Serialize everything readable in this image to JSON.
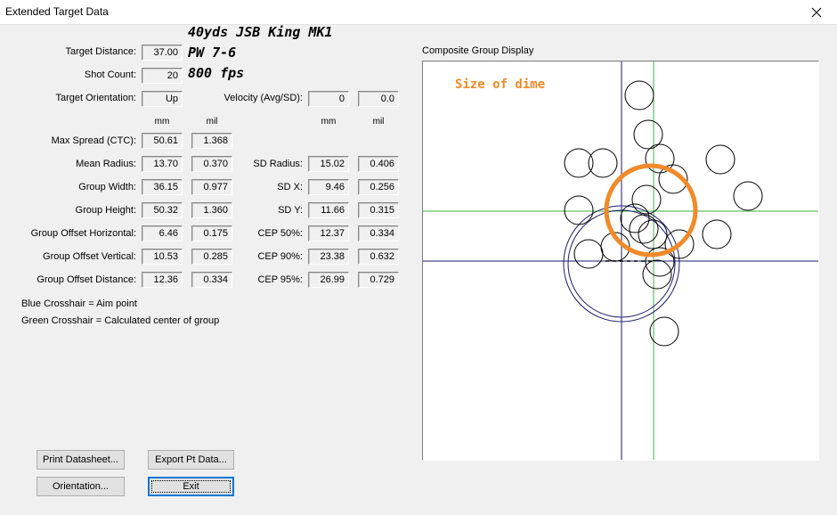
{
  "window": {
    "title": "Extended Target Data",
    "close_glyph": "✕"
  },
  "annotations": {
    "line1": "40yds JSB King MK1",
    "line2": "PW 7-6",
    "line3": "800 fps"
  },
  "labels": {
    "target_distance": "Target Distance:",
    "shot_count": "Shot Count:",
    "target_orientation": "Target Orientation:",
    "velocity": "Velocity (Avg/SD):",
    "max_spread": "Max Spread (CTC):",
    "mean_radius": "Mean Radius:",
    "group_width": "Group Width:",
    "group_height": "Group Height:",
    "offset_h": "Group Offset Horizontal:",
    "offset_v": "Group Offset Vertical:",
    "offset_d": "Group Offset Distance:",
    "sd_radius": "SD Radius:",
    "sd_x": "SD X:",
    "sd_y": "SD Y:",
    "cep50": "CEP 50%:",
    "cep90": "CEP 90%:",
    "cep95": "CEP 95%:"
  },
  "units": {
    "mm": "mm",
    "mil": "mil"
  },
  "values": {
    "target_distance": "37.00",
    "shot_count": "20",
    "target_orientation": "Up",
    "velocity_avg": "0",
    "velocity_sd": "0.0",
    "max_spread": {
      "mm": "50.61",
      "mil": "1.368"
    },
    "mean_radius": {
      "mm": "13.70",
      "mil": "0.370"
    },
    "group_width": {
      "mm": "36.15",
      "mil": "0.977"
    },
    "group_height": {
      "mm": "50.32",
      "mil": "1.360"
    },
    "offset_h": {
      "mm": "6.46",
      "mil": "0.175"
    },
    "offset_v": {
      "mm": "10.53",
      "mil": "0.285"
    },
    "offset_d": {
      "mm": "12.36",
      "mil": "0.334"
    },
    "sd_radius": {
      "mm": "15.02",
      "mil": "0.406"
    },
    "sd_x": {
      "mm": "9.46",
      "mil": "0.256"
    },
    "sd_y": {
      "mm": "11.66",
      "mil": "0.315"
    },
    "cep50": {
      "mm": "12.37",
      "mil": "0.334"
    },
    "cep90": {
      "mm": "23.38",
      "mil": "0.632"
    },
    "cep95": {
      "mm": "26.99",
      "mil": "0.729"
    }
  },
  "notes": {
    "blue": "Blue Crosshair = Aim point",
    "green": "Green Crosshair = Calculated center of group"
  },
  "buttons": {
    "print": "Print Datasheet...",
    "export": "Export Pt Data...",
    "orientation": "Orientation...",
    "exit": "Exit"
  },
  "plot": {
    "title": "Composite Group Display",
    "dime_label": "Size of dime",
    "colors": {
      "aim": "#1a1a6e",
      "center": "#3cb043",
      "dime": "#f08a2a",
      "shot": "#000000"
    }
  }
}
